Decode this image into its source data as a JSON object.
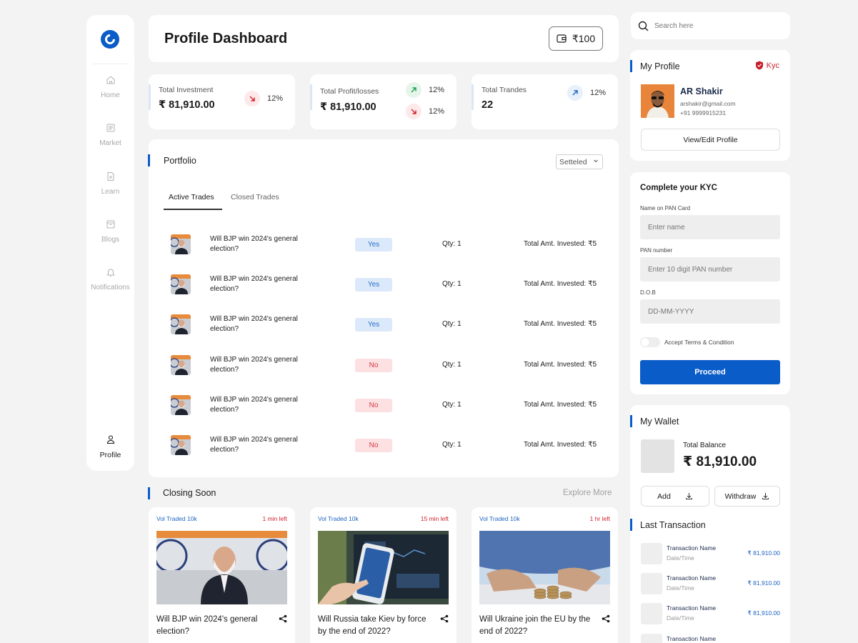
{
  "sidebar": {
    "items": [
      {
        "label": "Home",
        "icon": "home-icon"
      },
      {
        "label": "Market",
        "icon": "newspaper-icon"
      },
      {
        "label": "Learn",
        "icon": "document-icon"
      },
      {
        "label": "Blogs",
        "icon": "archive-icon"
      },
      {
        "label": "Notifications",
        "icon": "bell-icon"
      }
    ],
    "profile_label": "Profile"
  },
  "header": {
    "title": "Profile Dashboard",
    "wallet_balance": "₹100"
  },
  "stats": {
    "investment": {
      "label": "Total Investment",
      "value": "₹ 81,910.00",
      "change": "12%"
    },
    "profit": {
      "label": "Total Profit/losses",
      "value": "₹ 81,910.00",
      "up_change": "12%",
      "down_change": "12%"
    },
    "trades": {
      "label": "Total Trandes",
      "value": "22",
      "change": "12%"
    }
  },
  "portfolio": {
    "title": "Portfolio",
    "filter_value": "Setteled",
    "tabs": [
      "Active Trades",
      "Closed Trades"
    ],
    "trades": [
      {
        "question": "Will BJP win 2024's general election?",
        "answer": "Yes",
        "qty": "Qty: 1",
        "amount": "Total Amt. Invested: ₹5"
      },
      {
        "question": "Will BJP win 2024's general election?",
        "answer": "Yes",
        "qty": "Qty: 1",
        "amount": "Total Amt. Invested: ₹5"
      },
      {
        "question": "Will BJP win 2024's general election?",
        "answer": "Yes",
        "qty": "Qty: 1",
        "amount": "Total Amt. Invested: ₹5"
      },
      {
        "question": "Will BJP win 2024's general election?",
        "answer": "No",
        "qty": "Qty: 1",
        "amount": "Total Amt. Invested: ₹5"
      },
      {
        "question": "Will BJP win 2024's general election?",
        "answer": "No",
        "qty": "Qty: 1",
        "amount": "Total Amt. Invested: ₹5"
      },
      {
        "question": "Will BJP win 2024's general election?",
        "answer": "No",
        "qty": "Qty: 1",
        "amount": "Total Amt. Invested: ₹5"
      }
    ]
  },
  "closing": {
    "title": "Closing Soon",
    "explore": "Explore More",
    "cards": [
      {
        "vol": "Vol Traded 10k",
        "time_left": "1 min left",
        "question": "Will BJP win 2024's general election?"
      },
      {
        "vol": "Vol Traded 10k",
        "time_left": "15 min left",
        "question": "Will Russia take Kiev by force by the end of 2022?"
      },
      {
        "vol": "Vol Traded 10k",
        "time_left": "1 hr left",
        "question": "Will Ukraine join the EU by the end of 2022?"
      }
    ]
  },
  "search": {
    "placeholder": "Search here"
  },
  "profile": {
    "title": "My Profile",
    "kyc_label": "Kyc",
    "name": "AR Shakir",
    "email": "arshakir@gmail.com",
    "phone": "+91 9999915231",
    "edit_button": "View/Edit Profile"
  },
  "kyc_form": {
    "title": "Complete your KYC",
    "name_label": "Name on PAN Card",
    "name_placeholder": "Enter name",
    "pan_label": "PAN number",
    "pan_placeholder": "Enter 10 digit PAN number",
    "dob_label": "D.O.B",
    "dob_placeholder": "DD-MM-YYYY",
    "terms_label": "Accept Terms & Condition",
    "proceed_button": "Proceed"
  },
  "wallet": {
    "title": "My Wallet",
    "balance_label": "Total Balance",
    "balance_value": "₹ 81,910.00",
    "add_button": "Add",
    "withdraw_button": "Withdraw",
    "last_tx_title": "Last Transaction",
    "transactions": [
      {
        "name": "Transaction Name",
        "date": "Date/Time",
        "amount": "₹ 81,910.00"
      },
      {
        "name": "Transaction Name",
        "date": "Date/Time",
        "amount": "₹ 81,910.00"
      },
      {
        "name": "Transaction Name",
        "date": "Date/Time",
        "amount": "₹ 81,910.00"
      },
      {
        "name": "Transaction Name",
        "date": "",
        "amount": ""
      }
    ]
  },
  "colors": {
    "primary": "#0a5cc8",
    "danger": "#d01f2a",
    "success": "#1e9b4a",
    "background": "#f3f3f3"
  }
}
